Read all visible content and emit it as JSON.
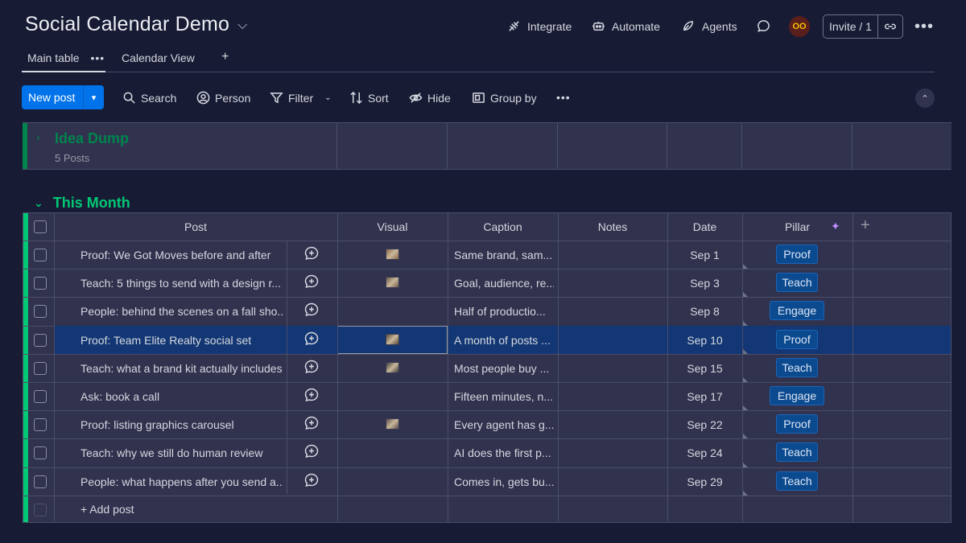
{
  "board": {
    "title": "Social Calendar Demo"
  },
  "topbar": {
    "integrate": "Integrate",
    "automate": "Automate",
    "agents": "Agents",
    "avatar_initials": "OO",
    "invite": "Invite / 1"
  },
  "tabs": [
    {
      "label": "Main table",
      "active": true
    },
    {
      "label": "Calendar View",
      "active": false
    }
  ],
  "toolbar": {
    "new_post": "New post",
    "search": "Search",
    "person": "Person",
    "filter": "Filter",
    "sort": "Sort",
    "hide": "Hide",
    "group_by": "Group by"
  },
  "groups": [
    {
      "name": "Idea Dump",
      "count_label": "5 Posts",
      "collapsed": true,
      "color": "#00c875"
    },
    {
      "name": "This Month",
      "collapsed": false,
      "color": "#00c875"
    }
  ],
  "columns": [
    "Post",
    "Visual",
    "Caption",
    "Notes",
    "Date",
    "Pillar"
  ],
  "rows": [
    {
      "post": "Proof: We Got Moves before and after",
      "has_visual": true,
      "caption": "Same brand, sam...",
      "notes": "",
      "date": "Sep 1",
      "pillar": "Proof"
    },
    {
      "post": "Teach: 5 things to send with a design r...",
      "has_visual": true,
      "caption": "Goal, audience, re...",
      "notes": "",
      "date": "Sep 3",
      "pillar": "Teach"
    },
    {
      "post": "People: behind the scenes on a fall sho...",
      "has_visual": false,
      "caption": "Half of productio...",
      "notes": "",
      "date": "Sep 8",
      "pillar": "Engage"
    },
    {
      "post": "Proof: Team Elite Realty social set",
      "has_visual": true,
      "caption": "A month of posts ...",
      "notes": "",
      "date": "Sep 10",
      "pillar": "Proof",
      "selected": true
    },
    {
      "post": "Teach: what a brand kit actually includes",
      "has_visual": true,
      "caption": "Most people buy ...",
      "notes": "",
      "date": "Sep 15",
      "pillar": "Teach"
    },
    {
      "post": "Ask: book a call",
      "has_visual": false,
      "caption": "Fifteen minutes, n...",
      "notes": "",
      "date": "Sep 17",
      "pillar": "Engage"
    },
    {
      "post": "Proof: listing graphics carousel",
      "has_visual": true,
      "caption": "Every agent has g...",
      "notes": "",
      "date": "Sep 22",
      "pillar": "Proof"
    },
    {
      "post": "Teach: why we still do human review",
      "has_visual": false,
      "caption": "AI does the first p...",
      "notes": "",
      "date": "Sep 24",
      "pillar": "Teach"
    },
    {
      "post": "People: what happens after you send a...",
      "has_visual": false,
      "caption": "Comes in, gets bu...",
      "notes": "",
      "date": "Sep 29",
      "pillar": "Teach"
    }
  ],
  "add_post": "+ Add post",
  "colors": {
    "accent": "#0073ea",
    "group_green": "#00c875",
    "selected_row": "#133774",
    "pill": "#0c4a8f"
  }
}
